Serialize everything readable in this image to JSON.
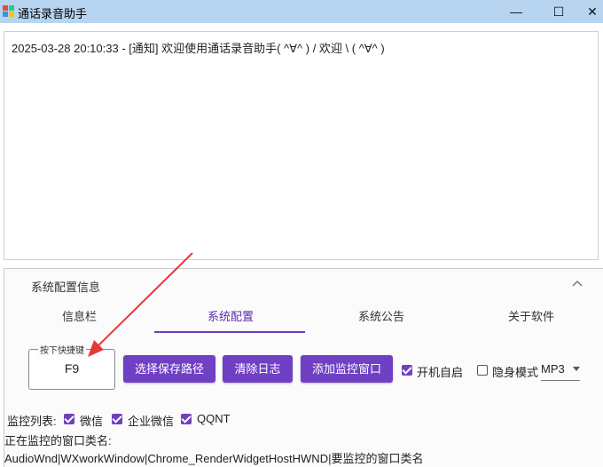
{
  "window": {
    "title": "通话录音助手",
    "controls": {
      "minimize": "—",
      "maximize": "☐",
      "close": "✕"
    }
  },
  "log": {
    "lines": [
      "2025-03-28 20:10:33 - [通知] 欢迎使用通话录音助手( ^∀^ )  / 欢迎 \\ ( ^∀^ )"
    ]
  },
  "config": {
    "panel_title": "系统配置信息",
    "tabs": [
      {
        "label": "信息栏",
        "active": false
      },
      {
        "label": "系统配置",
        "active": true
      },
      {
        "label": "系统公告",
        "active": false
      },
      {
        "label": "关于软件",
        "active": false
      }
    ],
    "hotkey": {
      "label": "按下快捷键",
      "value": "F9"
    },
    "buttons": {
      "save_path": "选择保存路径",
      "clear_log": "清除日志",
      "add_window": "添加监控窗口"
    },
    "options": {
      "autostart_label": "开机自启",
      "autostart": true,
      "stealth_label": "隐身模式",
      "stealth": false
    },
    "format": {
      "selected": "MP3"
    },
    "monitor": {
      "label": "监控列表:",
      "items": [
        {
          "label": "微信",
          "checked": true
        },
        {
          "label": "企业微信",
          "checked": true
        },
        {
          "label": "QQNT",
          "checked": true
        }
      ],
      "classes_label": "正在监控的窗口类名:",
      "classes_value": "AudioWnd|WXworkWindow|Chrome_RenderWidgetHostHWND|要监控的窗口类名"
    }
  },
  "colors": {
    "accent": "#6f3fc4",
    "titlebar": "#b7d4f1",
    "annotation_arrow": "#e53935"
  }
}
